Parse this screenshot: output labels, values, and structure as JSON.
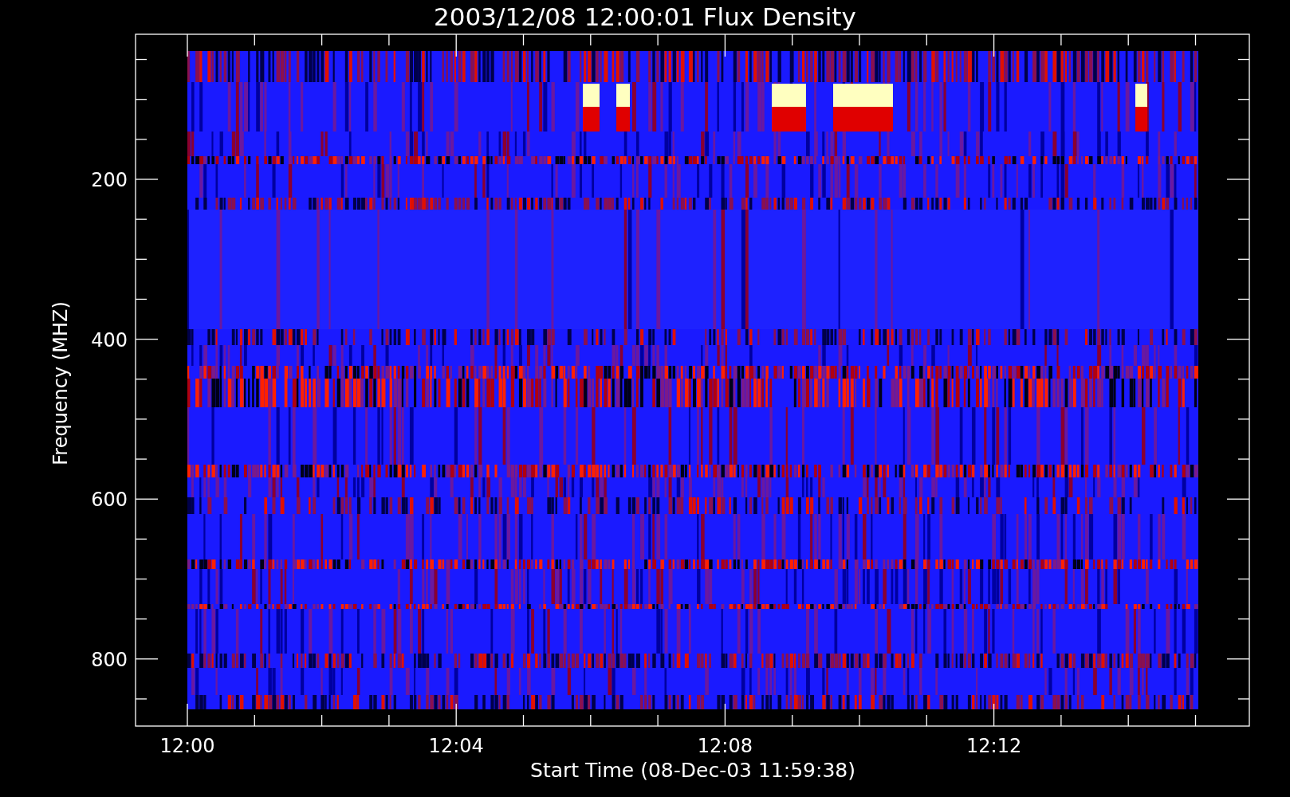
{
  "plot": {
    "title": "2003/12/08 12:00:01 Flux Density",
    "y_axis": {
      "label": "Frequency (MHZ)",
      "ticks": [
        "200",
        "400",
        "600",
        "800"
      ]
    },
    "x_axis": {
      "label": "Start Time (08-Dec-03 11:59:38)",
      "ticks": [
        "12:00",
        "12:04",
        "12:08",
        "12:12"
      ]
    }
  }
}
